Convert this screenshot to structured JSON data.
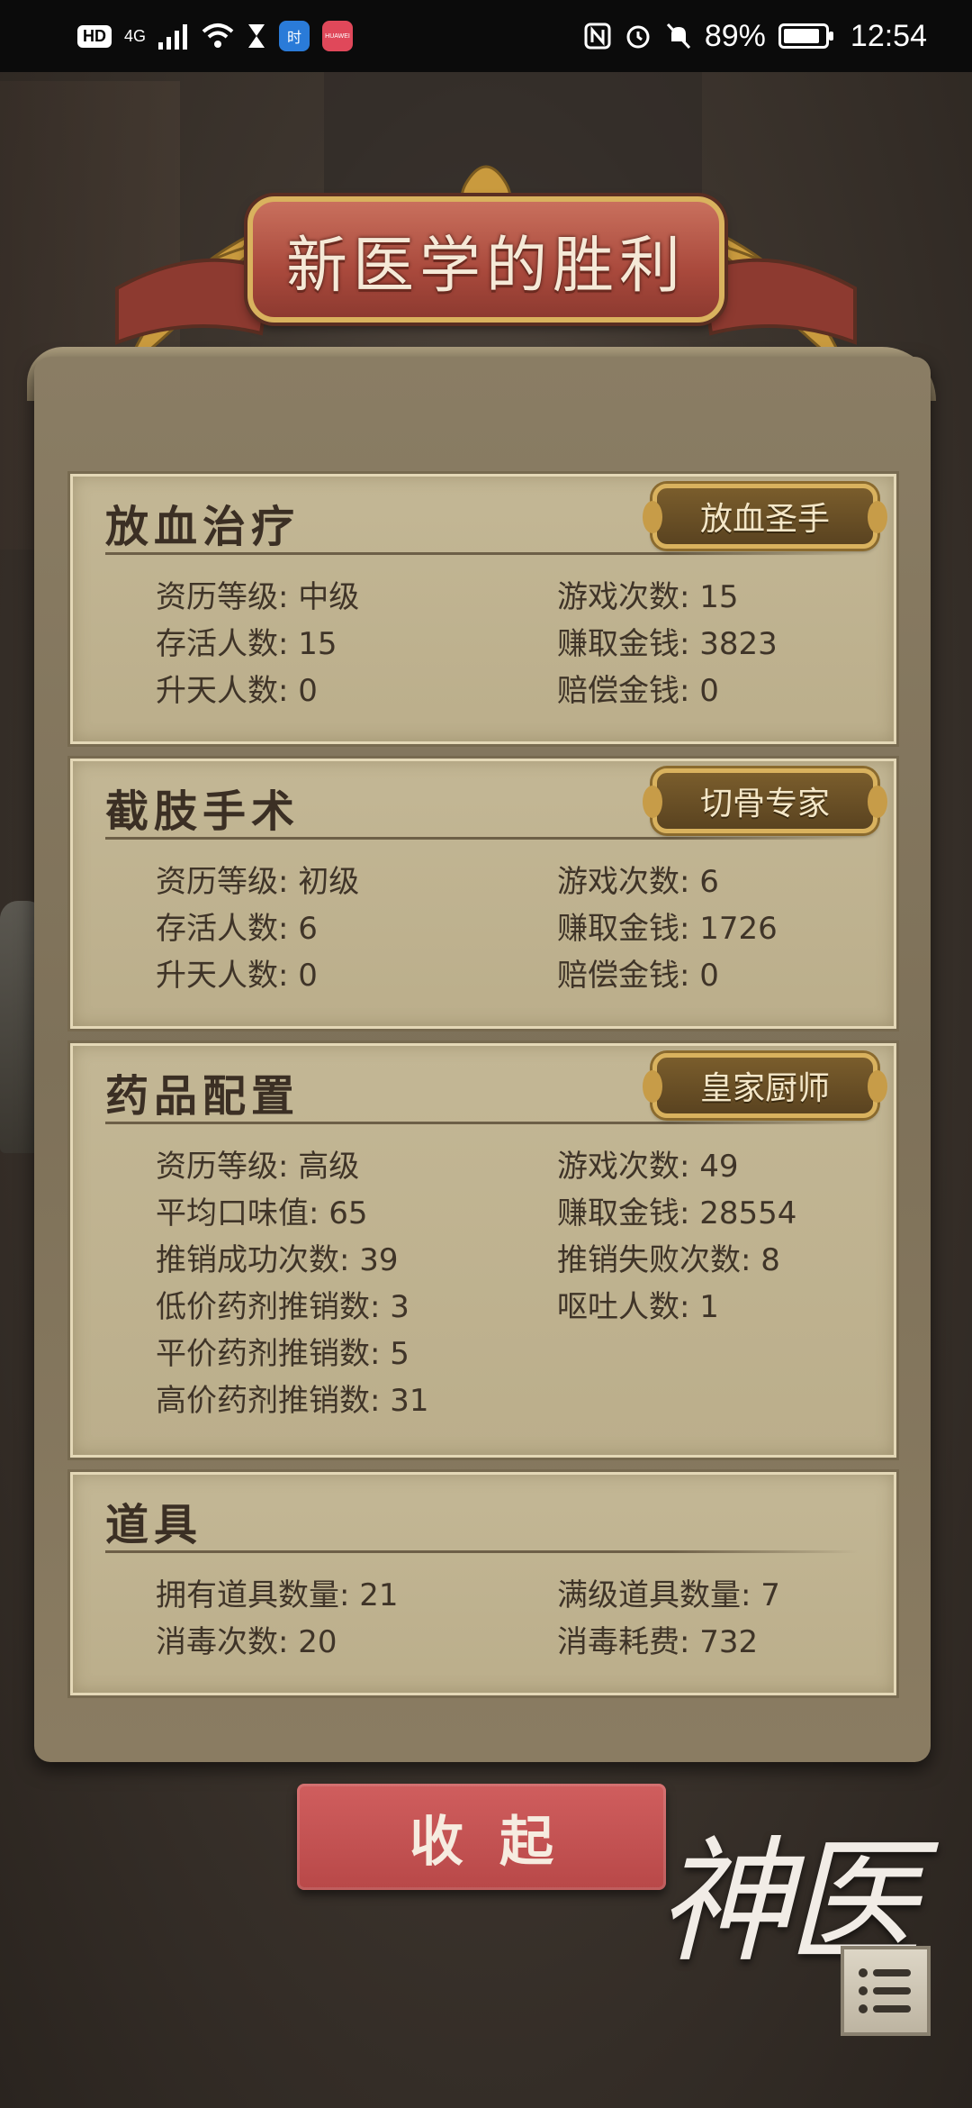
{
  "status_bar": {
    "hd": "HD",
    "network": "4G",
    "signal": "",
    "app1": "时",
    "app2": "HUAWEI",
    "battery": "89%",
    "battery_level": 0.89,
    "time": "12:54"
  },
  "title": "新医学的胜利",
  "sections": [
    {
      "title": "放血治疗",
      "badge": "放血圣手",
      "stats": [
        {
          "label": "资历等级",
          "value": "中级"
        },
        {
          "label": "游戏次数",
          "value": "15"
        },
        {
          "label": "存活人数",
          "value": "15"
        },
        {
          "label": "赚取金钱",
          "value": "3823"
        },
        {
          "label": "升天人数",
          "value": "0"
        },
        {
          "label": "赔偿金钱",
          "value": "0"
        }
      ]
    },
    {
      "title": "截肢手术",
      "badge": "切骨专家",
      "stats": [
        {
          "label": "资历等级",
          "value": "初级"
        },
        {
          "label": "游戏次数",
          "value": "6"
        },
        {
          "label": "存活人数",
          "value": "6"
        },
        {
          "label": "赚取金钱",
          "value": "1726"
        },
        {
          "label": "升天人数",
          "value": "0"
        },
        {
          "label": "赔偿金钱",
          "value": "0"
        }
      ]
    },
    {
      "title": "药品配置",
      "badge": "皇家厨师",
      "stats": [
        {
          "label": "资历等级",
          "value": "高级"
        },
        {
          "label": "游戏次数",
          "value": "49"
        },
        {
          "label": "平均口味值",
          "value": "65"
        },
        {
          "label": "赚取金钱",
          "value": "28554"
        },
        {
          "label": "推销成功次数",
          "value": "39"
        },
        {
          "label": "推销失败次数",
          "value": "8"
        },
        {
          "label": "低价药剂推销数",
          "value": "3"
        },
        {
          "label": "呕吐人数",
          "value": "1"
        },
        {
          "label": "平价药剂推销数",
          "value": "5"
        },
        {
          "label": "高价药剂推销数",
          "value": "31"
        }
      ]
    },
    {
      "title": "道具",
      "stats": [
        {
          "label": "拥有道具数量",
          "value": "21"
        },
        {
          "label": "满级道具数量",
          "value": "7"
        },
        {
          "label": "消毒次数",
          "value": "20"
        },
        {
          "label": "消毒耗费",
          "value": "732"
        }
      ]
    }
  ],
  "collapse_button": "收起",
  "logo_text": "神医",
  "menu_icon": "list-menu-icon"
}
